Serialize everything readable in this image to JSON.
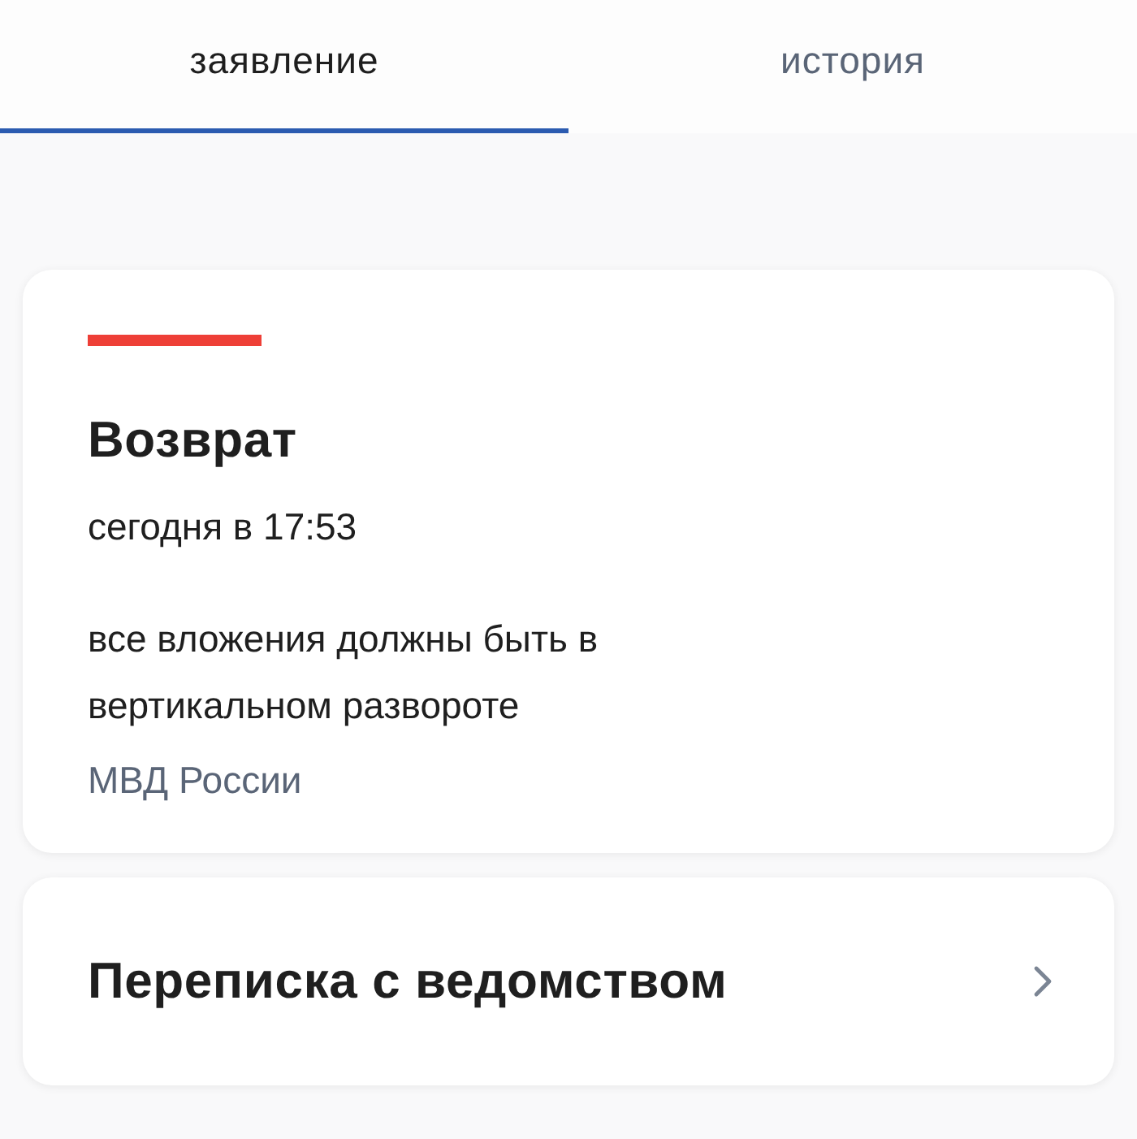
{
  "tabs": [
    {
      "label": "заявление",
      "selected": true
    },
    {
      "label": "история",
      "selected": false
    }
  ],
  "applications": [
    {
      "color": "#ee3f37",
      "status": "Возврат",
      "date": "сегодня в 17:53",
      "comment": "все вложения должны быть в вертикальном развороте",
      "agency": "МВД России"
    }
  ],
  "correspondence": {
    "label": "Переписка с ведомством"
  }
}
